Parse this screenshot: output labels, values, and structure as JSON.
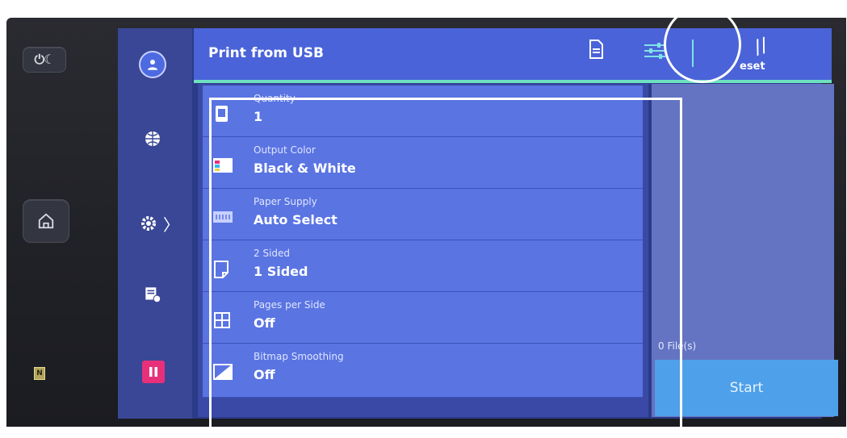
{
  "colors": {
    "header": "#4a63d9",
    "accent_line": "#6de0c1",
    "row": "#5a74e2",
    "start_button": "#4ea0ea",
    "pause_button": "#e8307a"
  },
  "hardware": {
    "power_icon": "power-sleep-icon",
    "home_icon": "home-icon",
    "nfc_label": "N"
  },
  "sidebar": {
    "items": [
      {
        "icon": "user-icon"
      },
      {
        "icon": "globe-icon"
      },
      {
        "icon": "gear-icon"
      },
      {
        "icon": "printer-info-icon"
      },
      {
        "icon": "pause-icon"
      }
    ]
  },
  "header": {
    "title": "Print from USB",
    "reset_label": "eset"
  },
  "settings": [
    {
      "label": "Quantity",
      "value": "1",
      "icon": "copy-icon"
    },
    {
      "label": "Output Color",
      "value": "Black & White",
      "icon": "color-icon"
    },
    {
      "label": "Paper Supply",
      "value": "Auto Select",
      "icon": "paper-tray-icon"
    },
    {
      "label": "2 Sided",
      "value": "1 Sided",
      "icon": "page-icon"
    },
    {
      "label": "Pages per Side",
      "value": "Off",
      "icon": "grid-icon"
    },
    {
      "label": "Bitmap Smoothing",
      "value": "Off",
      "icon": "smoothing-icon"
    }
  ],
  "panel": {
    "files": "0 File(s)",
    "start_label": "Start"
  }
}
